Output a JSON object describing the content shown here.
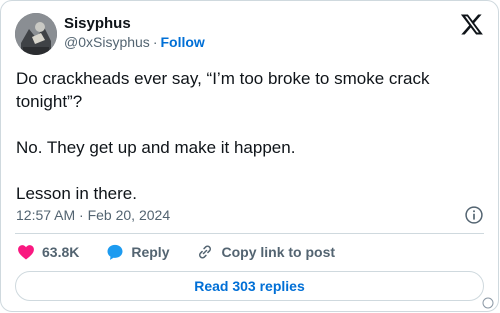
{
  "author": {
    "name": "Sisyphus",
    "handle": "@0xSisyphus",
    "separator": "·",
    "follow_label": "Follow"
  },
  "tweet": {
    "text": "Do crackheads ever say, “I’m too broke to smoke crack tonight”?\n\nNo. They get up and make it happen.\n\nLesson in there.",
    "timestamp": "12:57 AM · Feb 20, 2024"
  },
  "actions": {
    "like_count": "63.8K",
    "reply_label": "Reply",
    "copy_link_label": "Copy link to post"
  },
  "read_replies_label": "Read 303 replies",
  "colors": {
    "like": "#f91880",
    "reply": "#1d9bf0",
    "link": "#006fd6",
    "muted": "#536471",
    "border": "#cfd9de"
  },
  "icons": [
    "x-logo-icon",
    "info-icon",
    "heart-icon",
    "reply-bubble-icon",
    "link-icon"
  ]
}
